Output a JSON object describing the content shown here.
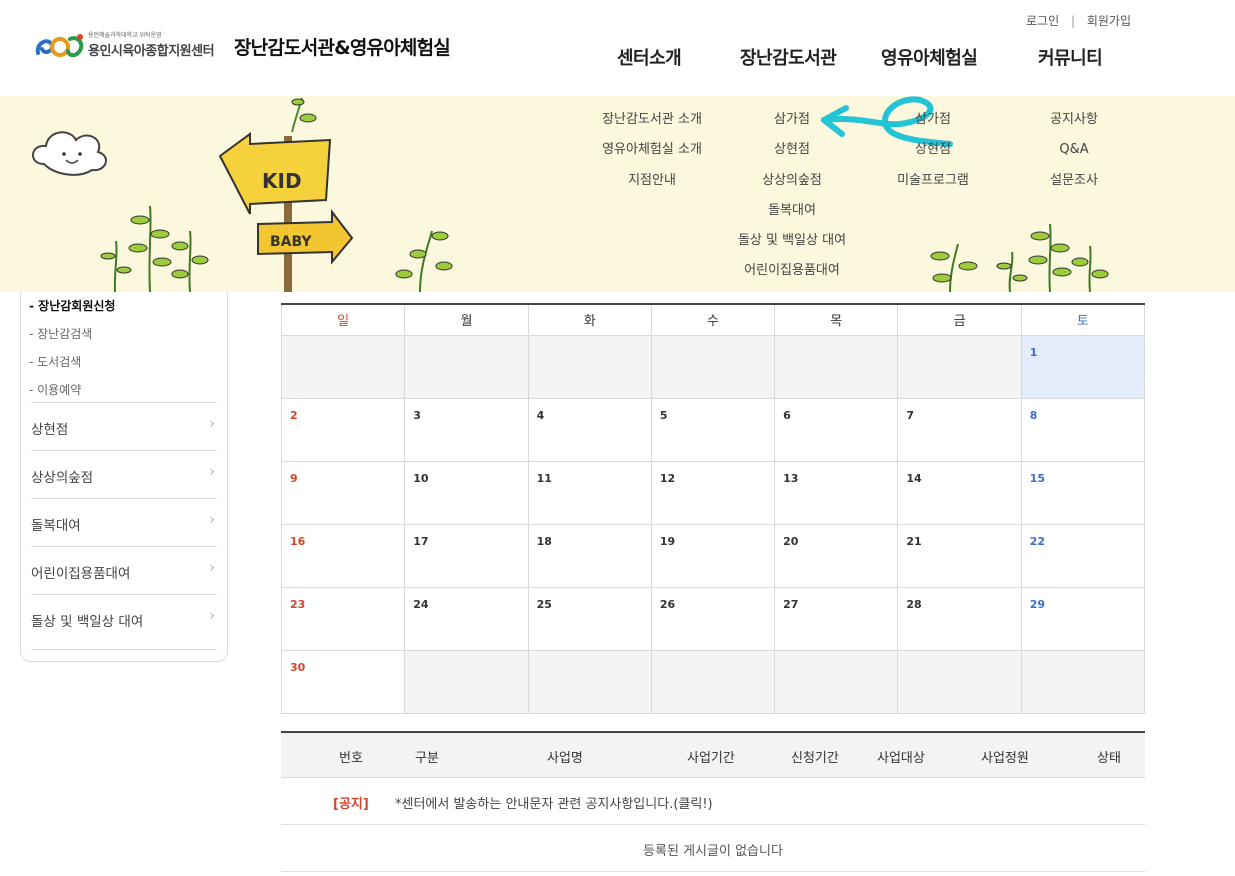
{
  "header": {
    "logo_small_text": "용인예술과학대학교 위탁운영",
    "logo_org": "용인시육아종합지원센터",
    "logo_title": "장난감도서관&영유아체험실",
    "login": "로그인",
    "separator": "|",
    "signup": "회원가입",
    "gnb": [
      "센터소개",
      "장난감도서관",
      "영유아체험실",
      "커뮤니티"
    ]
  },
  "submenu": {
    "col1": [
      "장난감도서관 소개",
      "영유아체험실 소개",
      "지점안내"
    ],
    "col2": [
      "삼가점",
      "상현점",
      "상상의숲점",
      "돌복대여",
      "돌상 및 백일상 대여",
      "어린이집용품대여"
    ],
    "col3": [
      "삼가점",
      "상현점",
      "미술프로그램"
    ],
    "col4": [
      "공지사항",
      "Q&A",
      "설문조사"
    ]
  },
  "banner": {
    "sign_top": "KID",
    "sign_bottom": "BABY",
    "annotation_color": "#22c4d6"
  },
  "lnb": {
    "subitems": [
      "- 장난감회원신청",
      "- 장난감검색",
      "- 도서검색",
      "- 이용예약"
    ],
    "items": [
      "상현점",
      "상상의숲점",
      "돌복대여",
      "어린이집용품대여",
      "돌상 및 백일상 대여"
    ],
    "chevron": "›"
  },
  "calendar": {
    "weekdays": [
      "일",
      "월",
      "화",
      "수",
      "목",
      "금",
      "토"
    ],
    "weeks": [
      [
        "",
        "",
        "",
        "",
        "",
        "",
        "1"
      ],
      [
        "2",
        "3",
        "4",
        "5",
        "6",
        "7",
        "8"
      ],
      [
        "9",
        "10",
        "11",
        "12",
        "13",
        "14",
        "15"
      ],
      [
        "16",
        "17",
        "18",
        "19",
        "20",
        "21",
        "22"
      ],
      [
        "23",
        "24",
        "25",
        "26",
        "27",
        "28",
        "29"
      ],
      [
        "30",
        "",
        "",
        "",
        "",
        "",
        ""
      ]
    ],
    "colors": {
      "sunday": "#d9452b",
      "saturday": "#3d6fc9",
      "today_bg": "#e3ecfb"
    }
  },
  "board": {
    "headers": [
      "번호",
      "구분",
      "사업명",
      "사업기간",
      "신청기간",
      "사업대상",
      "사업정원",
      "상태"
    ],
    "notice_tag": "[공지]",
    "notice_title": "*센터에서 발송하는 안내문자 관련 공지사항입니다.(클릭!)",
    "empty_text": "등록된 게시글이 없습니다"
  }
}
